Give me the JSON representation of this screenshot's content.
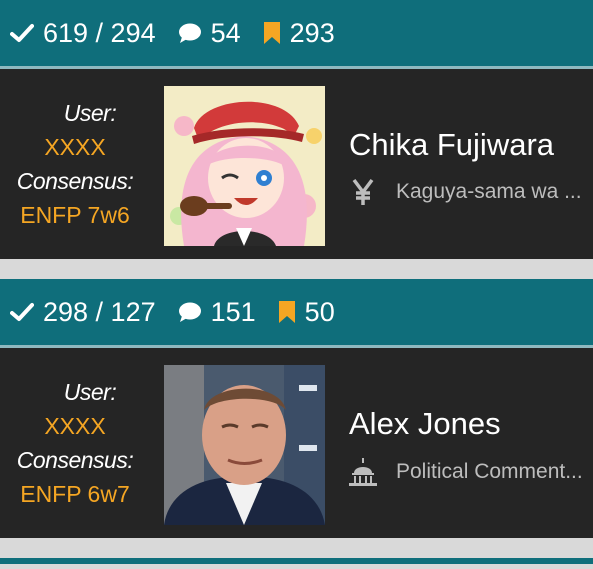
{
  "profiles": [
    {
      "stats": {
        "votes": "619 / 294",
        "comments": "54",
        "bookmarks": "293"
      },
      "user_label": "User:",
      "user_value": "XXXX",
      "consensus_label": "Consensus:",
      "consensus_value": "ENFP 7w6",
      "name": "Chika Fujiwara",
      "category_icon": "yen-icon",
      "category": "Kaguya-sama wa ..."
    },
    {
      "stats": {
        "votes": "298 / 127",
        "comments": "151",
        "bookmarks": "50"
      },
      "user_label": "User:",
      "user_value": "XXXX",
      "consensus_label": "Consensus:",
      "consensus_value": "ENFP 6w7",
      "name": "Alex Jones",
      "category_icon": "capitol-icon",
      "category": "Political Comment..."
    }
  ],
  "colors": {
    "teal": "#0f6e7b",
    "panel": "#252525",
    "accent": "#f5a623",
    "muted": "#bdbdbd"
  }
}
